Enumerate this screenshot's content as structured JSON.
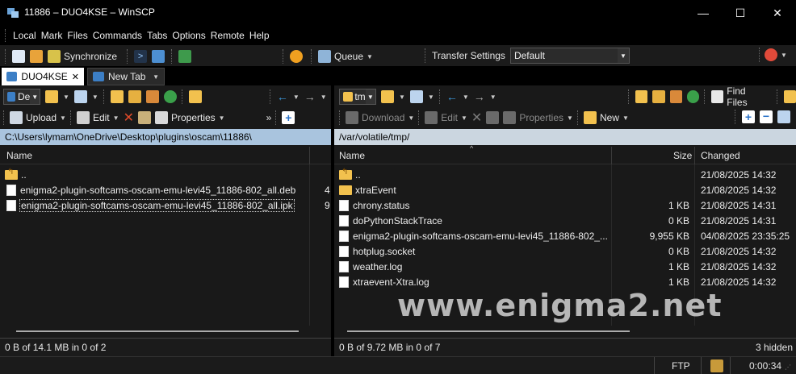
{
  "window": {
    "title": "11886 – DUO4KSE – WinSCP"
  },
  "menu": [
    "Local",
    "Mark",
    "Files",
    "Commands",
    "Tabs",
    "Options",
    "Remote",
    "Help"
  ],
  "toolbar": {
    "synchronize": "Synchronize",
    "queue": "Queue",
    "transfer_settings_label": "Transfer Settings",
    "transfer_settings_value": "Default"
  },
  "tabs": [
    {
      "label": "DUO4KSE",
      "close": "✕"
    },
    {
      "label": "New Tab"
    }
  ],
  "left": {
    "drive": "De",
    "upload": "Upload",
    "edit": "Edit",
    "properties": "Properties",
    "more": "»",
    "path": "C:\\Users\\lymam\\OneDrive\\Desktop\\plugins\\oscam\\11886\\",
    "col_name": "Name",
    "rows": [
      {
        "name": ".."
      },
      {
        "name": "enigma2-plugin-softcams-oscam-emu-levi45_11886-802_all.deb",
        "trail": "4"
      },
      {
        "name": "enigma2-plugin-softcams-oscam-emu-levi45_11886-802_all.ipk",
        "trail": "9"
      }
    ],
    "status": "0 B of 14.1 MB in 0 of 2"
  },
  "right": {
    "drive": "tm",
    "find_files": "Find Files",
    "download": "Download",
    "edit": "Edit",
    "properties": "Properties",
    "new": "New",
    "path": "/var/volatile/tmp/",
    "col_name": "Name",
    "col_size": "Size",
    "col_changed": "Changed",
    "rows": [
      {
        "name": "..",
        "size": "",
        "changed": "21/08/2025 14:32",
        "type": "up"
      },
      {
        "name": "xtraEvent",
        "size": "",
        "changed": "21/08/2025 14:32",
        "type": "folder"
      },
      {
        "name": "chrony.status",
        "size": "1 KB",
        "changed": "21/08/2025 14:31",
        "type": "file"
      },
      {
        "name": "doPythonStackTrace",
        "size": "0 KB",
        "changed": "21/08/2025 14:31",
        "type": "file"
      },
      {
        "name": "enigma2-plugin-softcams-oscam-emu-levi45_11886-802_...",
        "size": "9,955 KB",
        "changed": "04/08/2025 23:35:25",
        "type": "file"
      },
      {
        "name": "hotplug.socket",
        "size": "0 KB",
        "changed": "21/08/2025 14:32",
        "type": "file"
      },
      {
        "name": "weather.log",
        "size": "1 KB",
        "changed": "21/08/2025 14:32",
        "type": "file"
      },
      {
        "name": "xtraevent-Xtra.log",
        "size": "1 KB",
        "changed": "21/08/2025 14:32",
        "type": "file"
      }
    ],
    "status": "0 B of 9.72 MB in 0 of 7",
    "hidden": "3 hidden"
  },
  "bottom": {
    "protocol": "FTP",
    "time": "0:00:34"
  },
  "watermark": "www.enigma2.net"
}
